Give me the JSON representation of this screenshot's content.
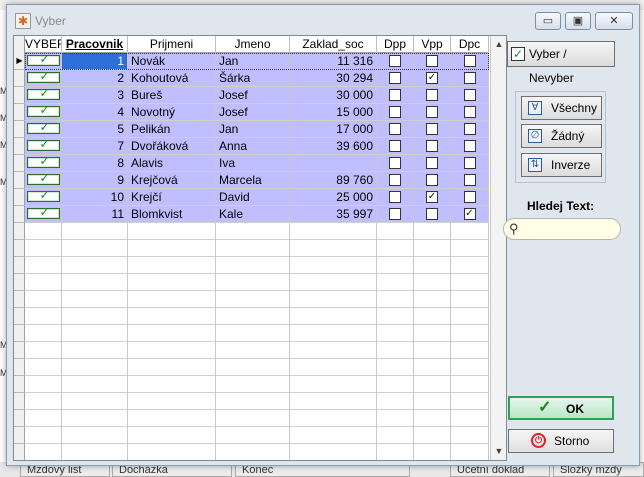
{
  "window": {
    "title": "Vyber"
  },
  "grid": {
    "columns": [
      "VYBER",
      "Pracovnik",
      "Prijmeni",
      "Jmeno",
      "Zaklad_soc",
      "Dpp",
      "Vpp",
      "Dpc"
    ],
    "rows": [
      {
        "vyber": true,
        "pracovnik": "1",
        "prijmeni": "Novák",
        "jmeno": "Jan",
        "zaklad_soc": "11 316",
        "dpp": false,
        "vpp": false,
        "dpc": false
      },
      {
        "vyber": true,
        "pracovnik": "2",
        "prijmeni": "Kohoutová",
        "jmeno": "Šárka",
        "zaklad_soc": "30 294",
        "dpp": false,
        "vpp": true,
        "dpc": false
      },
      {
        "vyber": true,
        "pracovnik": "3",
        "prijmeni": "Bureš",
        "jmeno": "Josef",
        "zaklad_soc": "30 000",
        "dpp": false,
        "vpp": false,
        "dpc": false
      },
      {
        "vyber": true,
        "pracovnik": "4",
        "prijmeni": "Novotný",
        "jmeno": "Josef",
        "zaklad_soc": "15 000",
        "dpp": false,
        "vpp": false,
        "dpc": false
      },
      {
        "vyber": true,
        "pracovnik": "5",
        "prijmeni": "Pelikán",
        "jmeno": "Jan",
        "zaklad_soc": "17 000",
        "dpp": false,
        "vpp": false,
        "dpc": false
      },
      {
        "vyber": true,
        "pracovnik": "7",
        "prijmeni": "Dvořáková",
        "jmeno": "Anna",
        "zaklad_soc": "39 600",
        "dpp": false,
        "vpp": false,
        "dpc": false
      },
      {
        "vyber": true,
        "pracovnik": "8",
        "prijmeni": "Alavis",
        "jmeno": "Iva",
        "zaklad_soc": "",
        "dpp": false,
        "vpp": false,
        "dpc": false
      },
      {
        "vyber": true,
        "pracovnik": "9",
        "prijmeni": "Krejčová",
        "jmeno": "Marcela",
        "zaklad_soc": "89 760",
        "dpp": false,
        "vpp": false,
        "dpc": false
      },
      {
        "vyber": true,
        "pracovnik": "10",
        "prijmeni": "Krejčí",
        "jmeno": "David",
        "zaklad_soc": "25 000",
        "dpp": false,
        "vpp": true,
        "dpc": false
      },
      {
        "vyber": true,
        "pracovnik": "11",
        "prijmeni": "Blomkvist",
        "jmeno": "Kale",
        "zaklad_soc": "35 997",
        "dpp": false,
        "vpp": false,
        "dpc": true
      }
    ],
    "empty_rows": 14
  },
  "buttons": {
    "vyber_nevyber": "Vyber / Nevyber",
    "vsechny": "Všechny",
    "zadny": "Žádný",
    "inverze": "Inverze",
    "ok": "OK",
    "storno": "Storno"
  },
  "search": {
    "label": "Hledej Text:",
    "value": ""
  },
  "background": {
    "tabs": [
      "Mzdový list",
      "Docházka",
      "Konec",
      "Účetní doklad",
      "Složky mzdy"
    ],
    "left_marks": [
      "M",
      "M",
      "M",
      "M",
      "M",
      "M"
    ]
  },
  "colors": {
    "selected_row": "#bfbfff",
    "current_cell": "#2c6fd6",
    "ok_border": "#2fa05a",
    "storno_icon": "#dd2222"
  }
}
